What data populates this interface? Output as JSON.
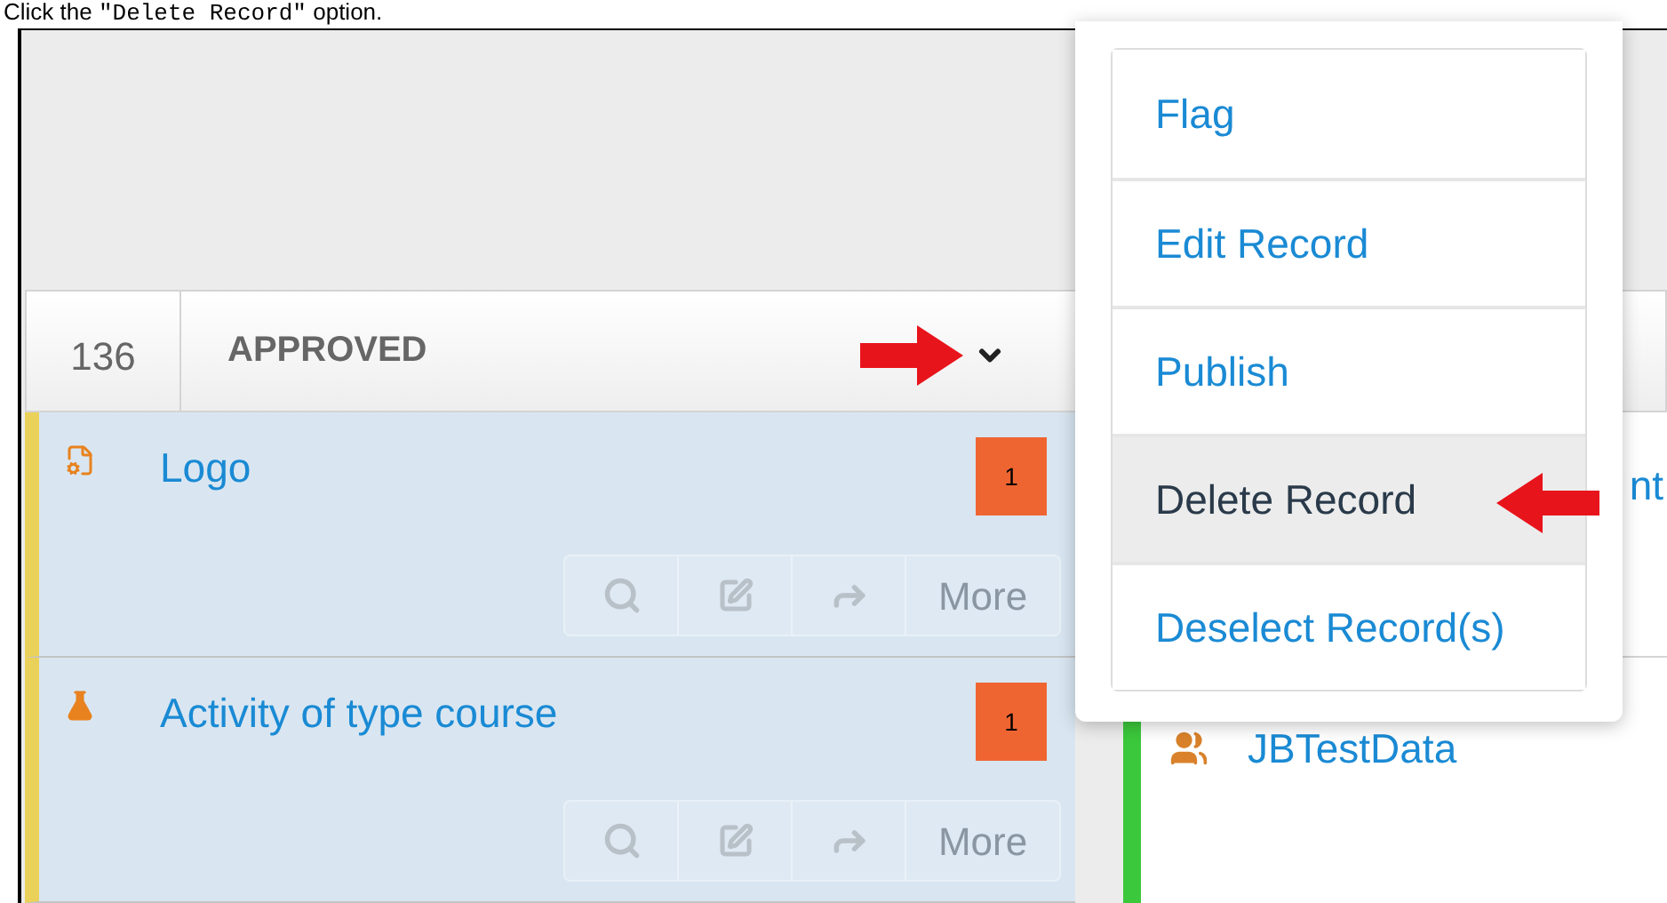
{
  "instruction": {
    "before": "Click the ",
    "code": "\"Delete Record\"",
    "after": " option."
  },
  "header": {
    "count": "136",
    "status": "APPROVED"
  },
  "records": [
    {
      "title": "Logo",
      "kind": "document",
      "badge": "1",
      "more": "More"
    },
    {
      "title": "Activity of type course",
      "kind": "flask",
      "badge": "1",
      "more": "More"
    }
  ],
  "right_column": {
    "title": "JBTestData",
    "kind": "people",
    "cut_text": "nt"
  },
  "menu": [
    {
      "label": "Flag",
      "selected": false
    },
    {
      "label": "Edit Record",
      "selected": false
    },
    {
      "label": "Publish",
      "selected": false
    },
    {
      "label": "Delete Record",
      "selected": true
    },
    {
      "label": "Deselect Record(s)",
      "selected": false
    }
  ]
}
